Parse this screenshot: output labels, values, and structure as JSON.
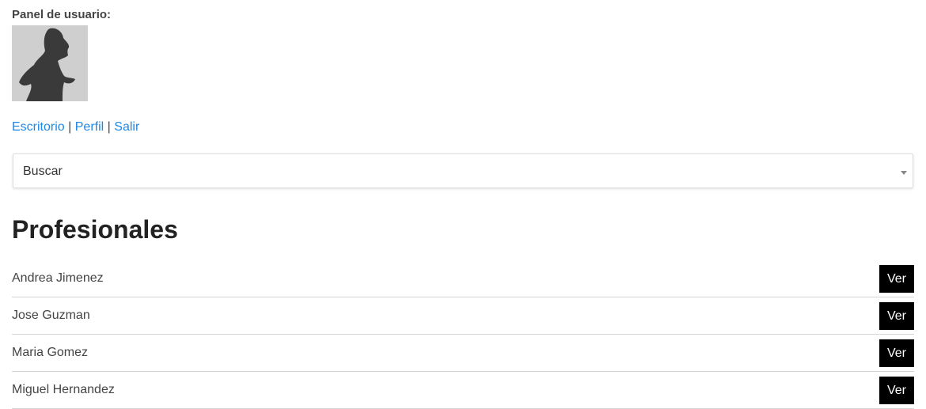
{
  "panel": {
    "label": "Panel de usuario:"
  },
  "user_links": [
    {
      "label": "Escritorio"
    },
    {
      "label": "Perfil"
    },
    {
      "label": "Salir"
    }
  ],
  "separator": "|",
  "search": {
    "label": "Buscar"
  },
  "professionals": {
    "title": "Profesionales",
    "items": [
      {
        "name": "Andrea Jimenez",
        "button_label": "Ver"
      },
      {
        "name": "Jose Guzman",
        "button_label": "Ver"
      },
      {
        "name": "Maria Gomez",
        "button_label": "Ver"
      },
      {
        "name": "Miguel Hernandez",
        "button_label": "Ver"
      }
    ]
  },
  "colors": {
    "link": "#1e88e5",
    "button_bg": "#000000",
    "avatar_bg": "#cfcfcf"
  }
}
